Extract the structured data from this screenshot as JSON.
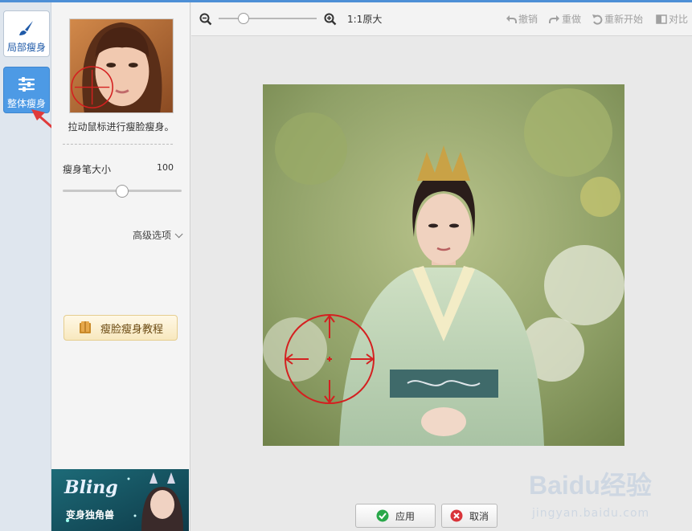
{
  "tabs": {
    "local_label": "局部瘦身",
    "whole_label": "整体瘦身"
  },
  "panel": {
    "hint": "拉动鼠标进行瘦脸瘦身。",
    "brush_size_label": "瘦身笔大小",
    "brush_size_value": "100",
    "brush_size_fraction": 0.5,
    "advanced_label": "高级选项",
    "tutorial_label": "瘦脸瘦身教程"
  },
  "ad": {
    "title": "Bling",
    "subtitle": "变身独角兽"
  },
  "toolbar": {
    "zoom_fraction": 0.25,
    "actual_size_label": "1:1原大",
    "undo_label": "撤销",
    "redo_label": "重做",
    "restart_label": "重新开始",
    "compare_label": "对比"
  },
  "actions": {
    "apply_label": "应用",
    "cancel_label": "取消"
  },
  "watermark": {
    "brand": "Baidu经验",
    "url": "jingyan.baidu.com"
  },
  "colors": {
    "accent": "#4d9ae5",
    "brush": "#d42020",
    "apply_icon": "#2aa84a",
    "cancel_icon": "#d9343a"
  }
}
